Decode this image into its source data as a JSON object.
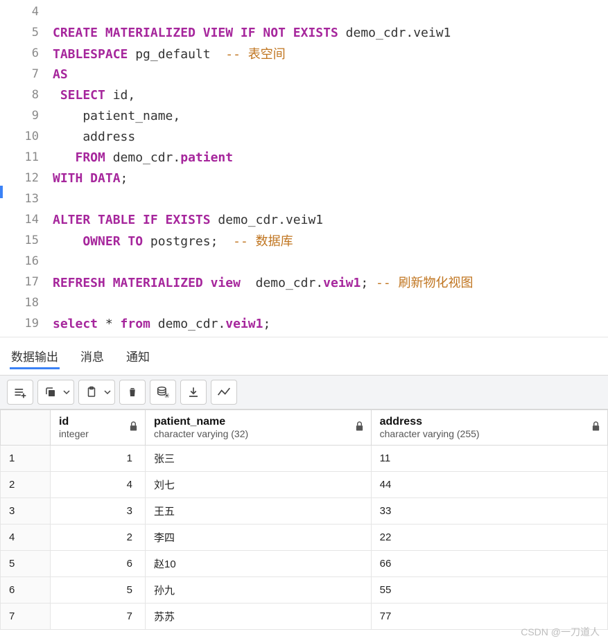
{
  "code_lines": [
    {
      "n": 4,
      "tokens": []
    },
    {
      "n": 5,
      "tokens": [
        {
          "t": "CREATE MATERIALIZED VIEW IF NOT EXISTS ",
          "c": "kw"
        },
        {
          "t": "demo_cdr",
          "c": "id"
        },
        {
          "t": ".",
          "c": "pn"
        },
        {
          "t": "veiw1",
          "c": "id"
        }
      ]
    },
    {
      "n": 6,
      "tokens": [
        {
          "t": "TABLESPACE ",
          "c": "kw"
        },
        {
          "t": "pg_default  ",
          "c": "id"
        },
        {
          "t": "-- 表空间",
          "c": "cm"
        }
      ]
    },
    {
      "n": 7,
      "tokens": [
        {
          "t": "AS",
          "c": "kw"
        }
      ]
    },
    {
      "n": 8,
      "tokens": [
        {
          "t": " SELECT ",
          "c": "kw"
        },
        {
          "t": "id,",
          "c": "id"
        }
      ]
    },
    {
      "n": 9,
      "tokens": [
        {
          "t": "    patient_name,",
          "c": "id"
        }
      ]
    },
    {
      "n": 10,
      "tokens": [
        {
          "t": "    address",
          "c": "id"
        }
      ]
    },
    {
      "n": 11,
      "tokens": [
        {
          "t": "   FROM ",
          "c": "kw"
        },
        {
          "t": "demo_cdr",
          "c": "id"
        },
        {
          "t": ".",
          "c": "pn"
        },
        {
          "t": "patient",
          "c": "kw"
        }
      ]
    },
    {
      "n": 12,
      "tokens": [
        {
          "t": "WITH DATA",
          "c": "kw"
        },
        {
          "t": ";",
          "c": "pn"
        }
      ]
    },
    {
      "n": 13,
      "tokens": []
    },
    {
      "n": 14,
      "tokens": [
        {
          "t": "ALTER TABLE IF EXISTS ",
          "c": "kw"
        },
        {
          "t": "demo_cdr.veiw1",
          "c": "id"
        }
      ]
    },
    {
      "n": 15,
      "tokens": [
        {
          "t": "    OWNER TO ",
          "c": "kw"
        },
        {
          "t": "postgres;  ",
          "c": "id"
        },
        {
          "t": "-- 数据库",
          "c": "cm"
        }
      ]
    },
    {
      "n": 16,
      "tokens": [
        {
          "t": "    ",
          "c": "id"
        }
      ]
    },
    {
      "n": 17,
      "tokens": [
        {
          "t": "REFRESH MATERIALIZED view  ",
          "c": "kw"
        },
        {
          "t": "demo_cdr",
          "c": "id"
        },
        {
          "t": ".",
          "c": "pn"
        },
        {
          "t": "veiw1",
          "c": "kw"
        },
        {
          "t": "; ",
          "c": "pn"
        },
        {
          "t": "-- 刷新物化视图",
          "c": "cm"
        }
      ]
    },
    {
      "n": 18,
      "tokens": []
    },
    {
      "n": 19,
      "tokens": [
        {
          "t": "select ",
          "c": "kw"
        },
        {
          "t": "* ",
          "c": "pn"
        },
        {
          "t": "from ",
          "c": "kw"
        },
        {
          "t": "demo_cdr",
          "c": "id"
        },
        {
          "t": ".",
          "c": "pn"
        },
        {
          "t": "veiw1",
          "c": "kw"
        },
        {
          "t": ";",
          "c": "pn"
        }
      ]
    }
  ],
  "panel_tabs": {
    "data_output": "数据输出",
    "messages": "消息",
    "notifications": "通知"
  },
  "columns": [
    {
      "name": "id",
      "type": "integer"
    },
    {
      "name": "patient_name",
      "type": "character varying (32)"
    },
    {
      "name": "address",
      "type": "character varying (255)"
    }
  ],
  "rows": [
    {
      "n": "1",
      "id": "1",
      "patient_name": "张三",
      "address": "11"
    },
    {
      "n": "2",
      "id": "4",
      "patient_name": "刘七",
      "address": "44"
    },
    {
      "n": "3",
      "id": "3",
      "patient_name": "王五",
      "address": "33"
    },
    {
      "n": "4",
      "id": "2",
      "patient_name": "李四",
      "address": "22"
    },
    {
      "n": "5",
      "id": "6",
      "patient_name": "赵10",
      "address": "66"
    },
    {
      "n": "6",
      "id": "5",
      "patient_name": "孙九",
      "address": "55"
    },
    {
      "n": "7",
      "id": "7",
      "patient_name": "苏苏",
      "address": "77"
    }
  ],
  "watermark": "CSDN @一刀道人"
}
